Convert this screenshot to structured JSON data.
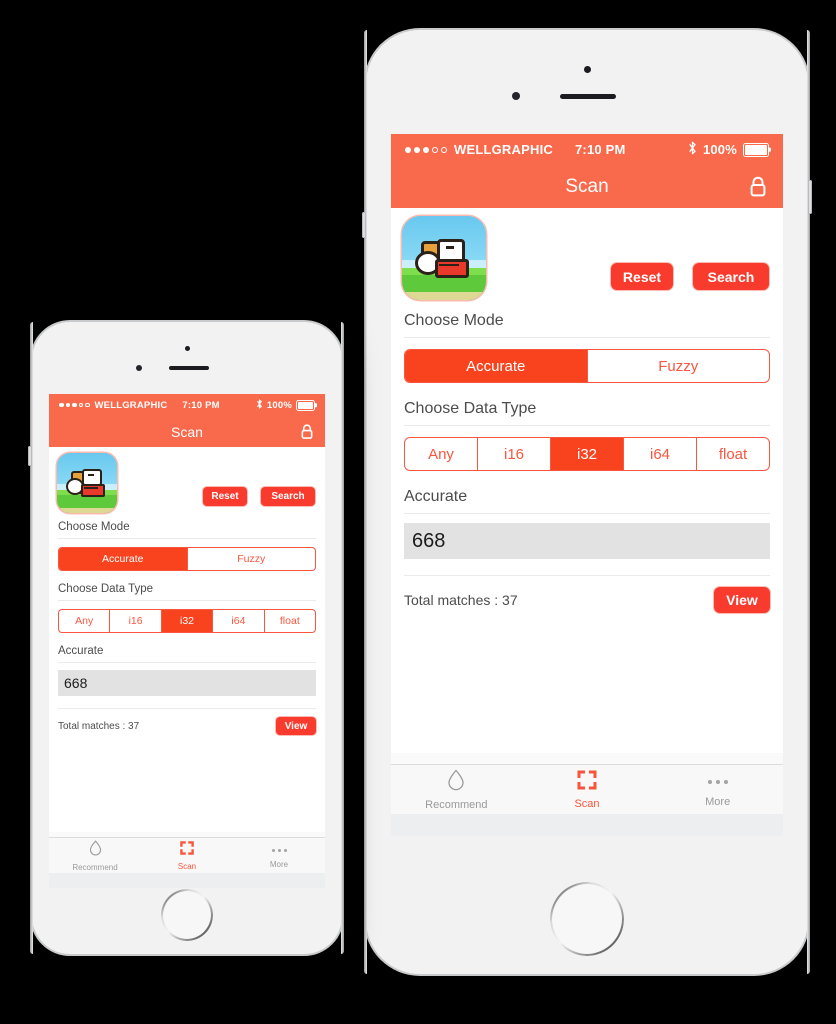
{
  "app": {
    "status_bar": {
      "signal_filled": 3,
      "signal_hollow": 2,
      "carrier": "WELLGRAPHIC",
      "time": "7:10 PM",
      "bluetooth_icon": "bluetooth-icon",
      "battery_percent": "100%"
    },
    "nav": {
      "title": "Scan",
      "lock_icon": "lock-icon"
    },
    "header": {
      "app_icon": "flappy-bird-app-icon",
      "reset_label": "Reset",
      "search_label": "Search"
    },
    "mode_section": {
      "label": "Choose Mode",
      "options": [
        {
          "label": "Accurate",
          "selected": true
        },
        {
          "label": "Fuzzy",
          "selected": false
        }
      ]
    },
    "datatype_section": {
      "label": "Choose Data Type",
      "options": [
        {
          "label": "Any",
          "selected": false
        },
        {
          "label": "i16",
          "selected": false
        },
        {
          "label": "i32",
          "selected": true
        },
        {
          "label": "i64",
          "selected": false
        },
        {
          "label": "float",
          "selected": false
        }
      ]
    },
    "value_section": {
      "label": "Accurate",
      "value": "668",
      "placeholder": "668"
    },
    "result": {
      "matches_label": "Total matches : 37",
      "view_label": "View"
    },
    "tabs": [
      {
        "label": "Recommend",
        "icon": "droplet-icon",
        "active": false
      },
      {
        "label": "Scan",
        "icon": "scan-frame-icon",
        "active": true
      },
      {
        "label": "More",
        "icon": "ellipsis-icon",
        "active": false
      }
    ],
    "colors": {
      "navbar": "#f96a4c",
      "accent": "#f9431f",
      "button": "#f93b2e",
      "segment_border": "#f9563f",
      "value_field": "#e2e2e2",
      "tab_active": "#f9543c",
      "tab_inactive": "#9a9a9a"
    }
  }
}
